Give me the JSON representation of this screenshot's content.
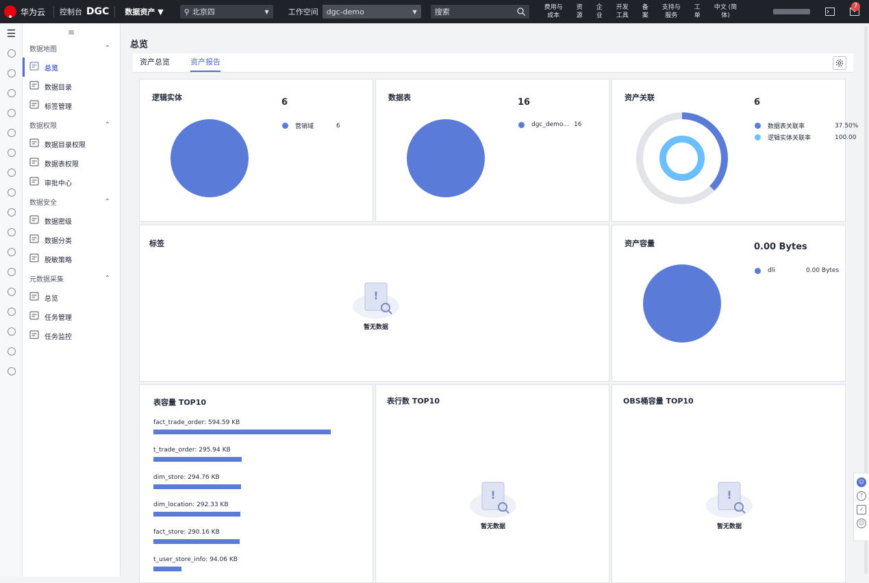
{
  "topbar": {
    "brand": "华为云",
    "console": "控制台",
    "product": "DGC",
    "module": "数据资产",
    "region": "北京四",
    "workspace_label": "工作空间",
    "workspace": "dgc-demo",
    "search_placeholder": "搜索",
    "links": [
      {
        "l1": "费用与",
        "l2": "成本"
      },
      {
        "l1": "资",
        "l2": "源"
      },
      {
        "l1": "企",
        "l2": "业"
      },
      {
        "l1": "开发",
        "l2": "工具"
      },
      {
        "l1": "备",
        "l2": "案"
      },
      {
        "l1": "支持与",
        "l2": "服务"
      },
      {
        "l1": "工",
        "l2": "单"
      },
      {
        "l1": "中文 (简",
        "l2": "体)"
      }
    ],
    "notifications": "7"
  },
  "sidebar": {
    "groups": [
      {
        "label": "数据地图",
        "items": [
          "总览",
          "数据目录",
          "标签管理"
        ]
      },
      {
        "label": "数据权限",
        "items": [
          "数据目录权限",
          "数据表权限",
          "审批中心"
        ]
      },
      {
        "label": "数据安全",
        "items": [
          "数据密级",
          "数据分类",
          "脱敏策略"
        ]
      },
      {
        "label": "元数据采集",
        "items": [
          "总览",
          "任务管理",
          "任务监控"
        ]
      }
    ]
  },
  "page": {
    "title": "总览",
    "tabs": [
      "资产总览",
      "资产报告"
    ],
    "active_tab": 1
  },
  "cards": {
    "logical": {
      "title": "逻辑实体",
      "total": "6",
      "legend": [
        {
          "name": "营销域",
          "value": "6",
          "color": "#5b7bd9"
        }
      ]
    },
    "tables": {
      "title": "数据表",
      "total": "16",
      "legend": [
        {
          "name": "dgc_demo...",
          "value": "16",
          "color": "#5b7bd9"
        }
      ]
    },
    "relation": {
      "title": "资产关联",
      "total": "6",
      "legend": [
        {
          "name": "数据表关联率",
          "value": "37.50%",
          "color": "#5b7bd9",
          "fraction": 0.375
        },
        {
          "name": "逻辑实体关联率",
          "value": "100.00",
          "color": "#6cbfff",
          "fraction": 1.0
        }
      ]
    },
    "tags": {
      "title": "标签",
      "empty": "暂无数据"
    },
    "capacity": {
      "title": "资产容量",
      "total": "0.00  Bytes",
      "legend": [
        {
          "name": "dli",
          "value": "0.00  Bytes",
          "color": "#5b7bd9"
        }
      ]
    },
    "table_top10": {
      "title": "表容量 TOP10",
      "rows": [
        {
          "label": "fact_trade_order: 594.59  KB",
          "value": 594.59
        },
        {
          "label": "t_trade_order: 295.94  KB",
          "value": 295.94
        },
        {
          "label": "dim_store: 294.76  KB",
          "value": 294.76
        },
        {
          "label": "dim_location: 292.33  KB",
          "value": 292.33
        },
        {
          "label": "fact_store: 290.16  KB",
          "value": 290.16
        },
        {
          "label": "t_user_store_info: 94.06  KB",
          "value": 94.06
        }
      ]
    },
    "rows_top10": {
      "title": "表行数 TOP10",
      "empty": "暂无数据"
    },
    "obs_top10": {
      "title": "OBS桶容量 TOP10",
      "empty": "暂无数据"
    }
  }
}
